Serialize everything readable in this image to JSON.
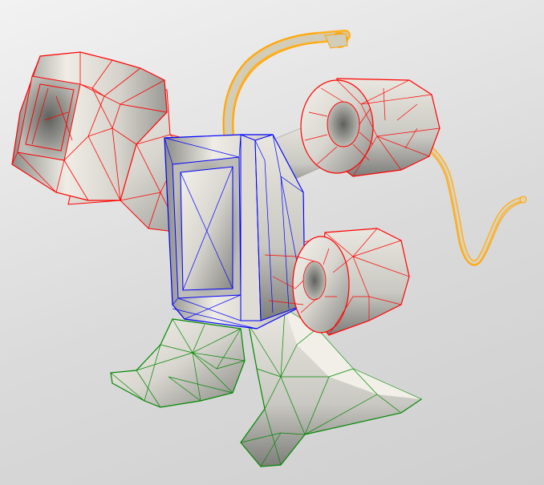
{
  "viewer": {
    "background": "#e3e3e3",
    "shape_fill": "#e6e4dc",
    "shape_shadow": "#8a8a86"
  },
  "parts": [
    {
      "name": "top-left-block",
      "color": "#ff0000"
    },
    {
      "name": "top-right-cylinder",
      "color": "#ff0000"
    },
    {
      "name": "lower-right-cylinder",
      "color": "#ff0000"
    },
    {
      "name": "torso-block",
      "color": "#0000ff"
    },
    {
      "name": "left-foot",
      "color": "#008800"
    },
    {
      "name": "right-foot",
      "color": "#008800"
    },
    {
      "name": "top-antenna",
      "color": "#ffa000"
    },
    {
      "name": "right-tail",
      "color": "#ffa000"
    }
  ]
}
